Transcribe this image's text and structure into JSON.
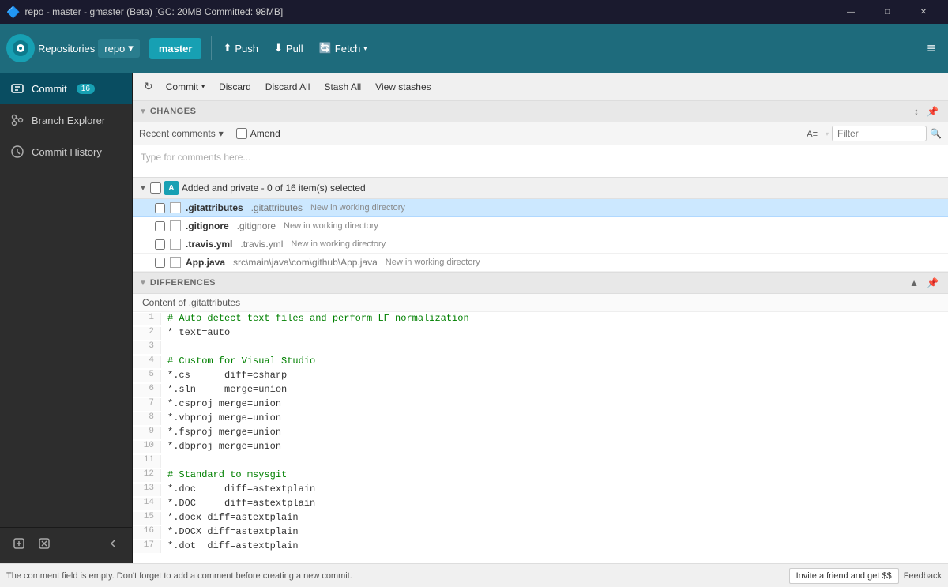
{
  "titlebar": {
    "title": "repo - master - gmaster (Beta) [GC: 20MB Committed: 98MB]",
    "min": "—",
    "max": "□",
    "close": "✕"
  },
  "toolbar": {
    "logo": "⊙",
    "repos_label": "Repositories",
    "repo_name": "repo",
    "branch_name": "master",
    "push_label": "Push",
    "pull_label": "Pull",
    "fetch_label": "Fetch",
    "more_icon": "≡"
  },
  "sidebar": {
    "items": [
      {
        "id": "commit",
        "label": "Commit",
        "badge": "16",
        "active": true
      },
      {
        "id": "branch-explorer",
        "label": "Branch Explorer",
        "active": false
      },
      {
        "id": "commit-history",
        "label": "Commit History",
        "active": false
      }
    ],
    "new_tab_label": "New tab",
    "close_tab_label": "Close tab"
  },
  "action_toolbar": {
    "refresh_icon": "↻",
    "commit_label": "Commit",
    "discard_label": "Discard",
    "discard_all_label": "Discard All",
    "stash_all_label": "Stash All",
    "view_stashes_label": "View stashes"
  },
  "changes_section": {
    "title": "Changes",
    "collapse_icon": "▼",
    "expand_icon": "↕",
    "pin_icon": "📌"
  },
  "comment": {
    "recent_comments_label": "Recent comments",
    "amend_label": "Amend",
    "placeholder": "Type for comments here...",
    "filter_placeholder": "Filter",
    "format_icon": "A≡",
    "search_icon": "🔍"
  },
  "file_group": {
    "group_letter": "A",
    "group_label": "Added and private - 0 of 16 item(s) selected",
    "files": [
      {
        "name": ".gitattributes",
        "path": ".gitattributes",
        "status": "New in working directory",
        "selected": true
      },
      {
        "name": ".gitignore",
        "path": ".gitignore",
        "status": "New in working directory",
        "selected": false
      },
      {
        "name": ".travis.yml",
        "path": ".travis.yml",
        "status": "New in working directory",
        "selected": false
      },
      {
        "name": "App.java",
        "path": "src\\main\\java\\com\\github\\App.java",
        "status": "New in working directory",
        "selected": false
      }
    ]
  },
  "differences": {
    "section_title": "Differences",
    "content_title": "Content of .gitattributes",
    "lines": [
      {
        "num": "1",
        "content": "# Auto detect text files and perform LF normalization"
      },
      {
        "num": "2",
        "content": "* text=auto"
      },
      {
        "num": "3",
        "content": ""
      },
      {
        "num": "4",
        "content": "# Custom for Visual Studio"
      },
      {
        "num": "5",
        "content": "*.cs      diff=csharp"
      },
      {
        "num": "6",
        "content": "*.sln     merge=union"
      },
      {
        "num": "7",
        "content": "*.csproj merge=union"
      },
      {
        "num": "8",
        "content": "*.vbproj merge=union"
      },
      {
        "num": "9",
        "content": "*.fsproj merge=union"
      },
      {
        "num": "10",
        "content": "*.dbproj merge=union"
      },
      {
        "num": "11",
        "content": ""
      },
      {
        "num": "12",
        "content": "# Standard to msysgit"
      },
      {
        "num": "13",
        "content": "*.doc     diff=astextplain"
      },
      {
        "num": "14",
        "content": "*.DOC     diff=astextplain"
      },
      {
        "num": "15",
        "content": "*.docx diff=astextplain"
      },
      {
        "num": "16",
        "content": "*.DOCX diff=astextplain"
      },
      {
        "num": "17",
        "content": "*.dot  diff=astextplain"
      }
    ],
    "up_icon": "▲",
    "pin_icon": "📌"
  },
  "statusbar": {
    "message": "The comment field is empty. Don't forget to add a comment before creating a new commit.",
    "invite_label": "Invite a friend and get $$",
    "feedback_label": "Feedback"
  }
}
